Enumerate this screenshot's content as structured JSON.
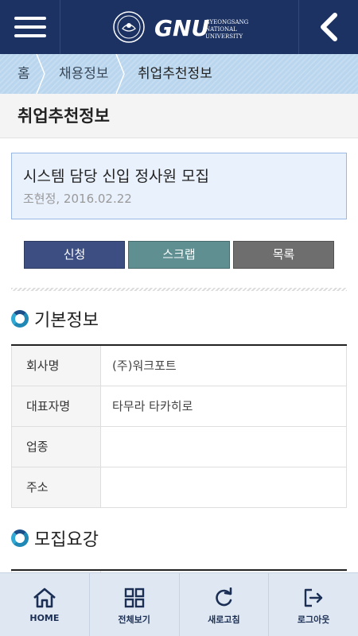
{
  "header": {
    "university_name_line1": "GYEONGSANG",
    "university_name_line2": "NATIONAL",
    "university_name_line3": "UNIVERSITY",
    "logo_mark": "GNU",
    "menu_icon": "hamburger-icon",
    "back_icon": "chevron-left-icon",
    "background": "#1b3263"
  },
  "breadcrumb": {
    "items": [
      "홈",
      "채용정보",
      "취업추천정보"
    ]
  },
  "page": {
    "title": "취업추천정보"
  },
  "job": {
    "title": "시스템 담당 신입 정사원 모집",
    "meta": "조현정, 2016.02.22"
  },
  "actions": {
    "apply": "신청",
    "scrap": "스크랩",
    "list": "목록"
  },
  "sections": {
    "basic_info": "기본정보",
    "recruit_info": "모집요강"
  },
  "basic_info_rows": [
    {
      "label": "회사명",
      "value": "(주)워크포트"
    },
    {
      "label": "대표자명",
      "value": "타무라 타카히로"
    },
    {
      "label": "업종",
      "value": ""
    },
    {
      "label": "주소",
      "value": ""
    }
  ],
  "bottom_nav": [
    {
      "label": "HOME",
      "icon": "home-icon"
    },
    {
      "label": "전체보기",
      "icon": "grid-icon"
    },
    {
      "label": "새로고침",
      "icon": "refresh-icon"
    },
    {
      "label": "로그아웃",
      "icon": "logout-icon"
    }
  ],
  "colors": {
    "accent_navy": "#1b3263",
    "breadcrumb_bg": "#b9d6ee",
    "apply_btn": "#3d4f82",
    "scrap_btn": "#5f8f91",
    "list_btn": "#6e6e6e",
    "nav_bg": "#dfe7f2"
  }
}
